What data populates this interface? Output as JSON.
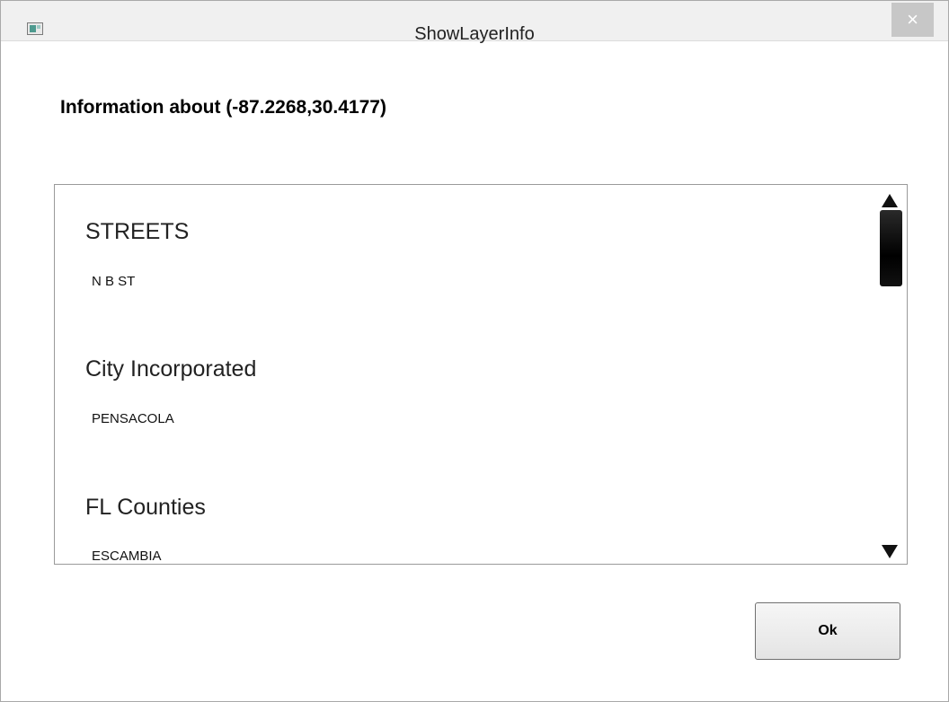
{
  "window": {
    "title": "ShowLayerInfo",
    "close_label": "×"
  },
  "heading": "Information about (-87.2268,30.4177)",
  "layers": [
    {
      "name": "STREETS",
      "value": "N B ST"
    },
    {
      "name": "City Incorporated",
      "value": "PENSACOLA"
    },
    {
      "name": "FL Counties",
      "value": "ESCAMBIA"
    }
  ],
  "buttons": {
    "ok_label": "Ok"
  },
  "icons": {
    "app": "window-app-icon",
    "close": "close-icon",
    "scroll_up": "scroll-up-arrow-icon",
    "scroll_down": "scroll-down-arrow-icon"
  }
}
